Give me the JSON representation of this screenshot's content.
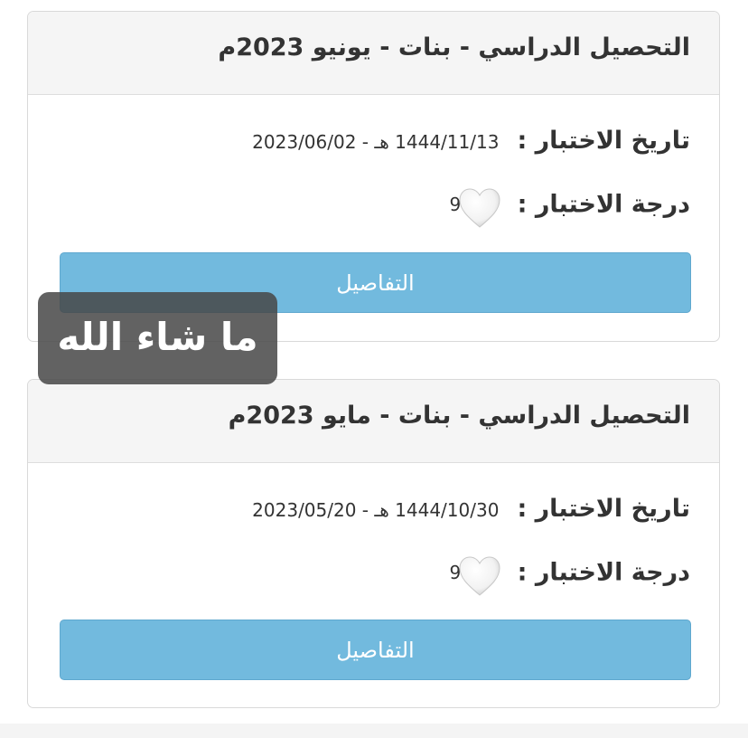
{
  "results": [
    {
      "title": "التحصيل الدراسي - بنات - يونيو 2023م",
      "date_label": "تاريخ الاختبار :",
      "date_value": "1444/11/13 هـ - 2023/06/02",
      "grade_label": "درجة الاختبار :",
      "grade_value": "9",
      "details_label": "التفاصيل"
    },
    {
      "title": "التحصيل الدراسي - بنات - مايو 2023م",
      "date_label": "تاريخ الاختبار :",
      "date_value": "1444/10/30 هـ - 2023/05/20",
      "grade_label": "درجة الاختبار :",
      "grade_value": "9",
      "details_label": "التفاصيل"
    }
  ],
  "sticker": {
    "text": "ما شاء الله"
  },
  "icons": {
    "grade_cover": "white-heart-icon"
  },
  "colors": {
    "button": "#72bade",
    "header_bg": "#f5f5f5",
    "border": "#d9d9d9"
  }
}
